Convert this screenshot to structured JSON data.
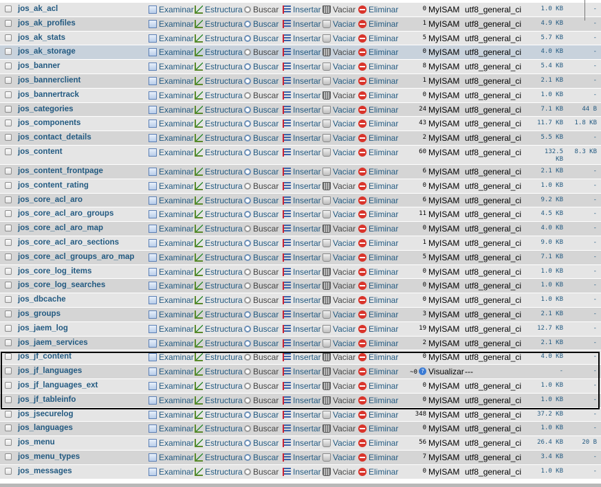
{
  "actions": {
    "examine": "Examinar",
    "structure": "Estructura",
    "search": "Buscar",
    "insert": "Insertar",
    "empty": "Vaciar",
    "drop": "Eliminar"
  },
  "tables": [
    {
      "name": "jos_ak_acl",
      "rows": "0",
      "engine": "MyISAM",
      "collation": "utf8_general_ci",
      "size": "1.0 KB",
      "overhead": "-"
    },
    {
      "name": "jos_ak_profiles",
      "rows": "1",
      "engine": "MyISAM",
      "collation": "utf8_general_ci",
      "size": "4.9 KB",
      "overhead": "-"
    },
    {
      "name": "jos_ak_stats",
      "rows": "5",
      "engine": "MyISAM",
      "collation": "utf8_general_ci",
      "size": "5.7 KB",
      "overhead": "-"
    },
    {
      "name": "jos_ak_storage",
      "rows": "0",
      "engine": "MyISAM",
      "collation": "utf8_general_ci",
      "size": "4.0 KB",
      "overhead": "-"
    },
    {
      "name": "jos_banner",
      "rows": "8",
      "engine": "MyISAM",
      "collation": "utf8_general_ci",
      "size": "5.4 KB",
      "overhead": "-"
    },
    {
      "name": "jos_bannerclient",
      "rows": "1",
      "engine": "MyISAM",
      "collation": "utf8_general_ci",
      "size": "2.1 KB",
      "overhead": "-"
    },
    {
      "name": "jos_bannertrack",
      "rows": "0",
      "engine": "MyISAM",
      "collation": "utf8_general_ci",
      "size": "1.0 KB",
      "overhead": "-"
    },
    {
      "name": "jos_categories",
      "rows": "24",
      "engine": "MyISAM",
      "collation": "utf8_general_ci",
      "size": "7.1 KB",
      "overhead": "44 B"
    },
    {
      "name": "jos_components",
      "rows": "43",
      "engine": "MyISAM",
      "collation": "utf8_general_ci",
      "size": "11.7 KB",
      "overhead": "1.8 KB"
    },
    {
      "name": "jos_contact_details",
      "rows": "2",
      "engine": "MyISAM",
      "collation": "utf8_general_ci",
      "size": "5.5 KB",
      "overhead": "-"
    },
    {
      "name": "jos_content",
      "rows": "60",
      "engine": "MyISAM",
      "collation": "utf8_general_ci",
      "size": "132.5 KB",
      "overhead": "8.3 KB"
    },
    {
      "name": "jos_content_frontpage",
      "rows": "6",
      "engine": "MyISAM",
      "collation": "utf8_general_ci",
      "size": "2.1 KB",
      "overhead": "-"
    },
    {
      "name": "jos_content_rating",
      "rows": "0",
      "engine": "MyISAM",
      "collation": "utf8_general_ci",
      "size": "1.0 KB",
      "overhead": "-"
    },
    {
      "name": "jos_core_acl_aro",
      "rows": "6",
      "engine": "MyISAM",
      "collation": "utf8_general_ci",
      "size": "9.2 KB",
      "overhead": "-"
    },
    {
      "name": "jos_core_acl_aro_groups",
      "rows": "11",
      "engine": "MyISAM",
      "collation": "utf8_general_ci",
      "size": "4.5 KB",
      "overhead": "-"
    },
    {
      "name": "jos_core_acl_aro_map",
      "rows": "0",
      "engine": "MyISAM",
      "collation": "utf8_general_ci",
      "size": "4.0 KB",
      "overhead": "-"
    },
    {
      "name": "jos_core_acl_aro_sections",
      "rows": "1",
      "engine": "MyISAM",
      "collation": "utf8_general_ci",
      "size": "9.0 KB",
      "overhead": "-"
    },
    {
      "name": "jos_core_acl_groups_aro_map",
      "rows": "5",
      "engine": "MyISAM",
      "collation": "utf8_general_ci",
      "size": "7.1 KB",
      "overhead": "-"
    },
    {
      "name": "jos_core_log_items",
      "rows": "0",
      "engine": "MyISAM",
      "collation": "utf8_general_ci",
      "size": "1.0 KB",
      "overhead": "-"
    },
    {
      "name": "jos_core_log_searches",
      "rows": "0",
      "engine": "MyISAM",
      "collation": "utf8_general_ci",
      "size": "1.0 KB",
      "overhead": "-"
    },
    {
      "name": "jos_dbcache",
      "rows": "0",
      "engine": "MyISAM",
      "collation": "utf8_general_ci",
      "size": "1.0 KB",
      "overhead": "-"
    },
    {
      "name": "jos_groups",
      "rows": "3",
      "engine": "MyISAM",
      "collation": "utf8_general_ci",
      "size": "2.1 KB",
      "overhead": "-"
    },
    {
      "name": "jos_jaem_log",
      "rows": "19",
      "engine": "MyISAM",
      "collation": "utf8_general_ci",
      "size": "12.7 KB",
      "overhead": "-"
    },
    {
      "name": "jos_jaem_services",
      "rows": "2",
      "engine": "MyISAM",
      "collation": "utf8_general_ci",
      "size": "2.1 KB",
      "overhead": "-"
    },
    {
      "name": "jos_jf_content",
      "rows": "0",
      "engine": "MyISAM",
      "collation": "utf8_general_ci",
      "size": "4.0 KB",
      "overhead": "-"
    },
    {
      "name": "jos_jf_languages",
      "rows": "~0",
      "engine": "Visualizar",
      "collation": "---",
      "size": "-",
      "overhead": "-"
    },
    {
      "name": "jos_jf_languages_ext",
      "rows": "0",
      "engine": "MyISAM",
      "collation": "utf8_general_ci",
      "size": "1.0 KB",
      "overhead": "-"
    },
    {
      "name": "jos_jf_tableinfo",
      "rows": "0",
      "engine": "MyISAM",
      "collation": "utf8_general_ci",
      "size": "1.0 KB",
      "overhead": "-"
    },
    {
      "name": "jos_jsecurelog",
      "rows": "348",
      "engine": "MyISAM",
      "collation": "utf8_general_ci",
      "size": "37.2 KB",
      "overhead": "-"
    },
    {
      "name": "jos_languages",
      "rows": "0",
      "engine": "MyISAM",
      "collation": "utf8_general_ci",
      "size": "1.0 KB",
      "overhead": "-"
    },
    {
      "name": "jos_menu",
      "rows": "56",
      "engine": "MyISAM",
      "collation": "utf8_general_ci",
      "size": "26.4 KB",
      "overhead": "20 B"
    },
    {
      "name": "jos_menu_types",
      "rows": "7",
      "engine": "MyISAM",
      "collation": "utf8_general_ci",
      "size": "3.4 KB",
      "overhead": "-"
    },
    {
      "name": "jos_messages",
      "rows": "0",
      "engine": "MyISAM",
      "collation": "utf8_general_ci",
      "size": "1.0 KB",
      "overhead": "-"
    }
  ],
  "colors": {
    "link": "#235a81",
    "row_odd": "#e5e5e5",
    "row_even": "#d5d5d5",
    "row_selected": "#c8d2dc",
    "drop_icon": "#d9342b"
  },
  "icons": {
    "examine": "browse-icon",
    "structure": "structure-icon",
    "search": "search-icon",
    "insert": "insert-icon",
    "empty": "empty-icon",
    "drop": "drop-icon",
    "help": "help-icon"
  }
}
